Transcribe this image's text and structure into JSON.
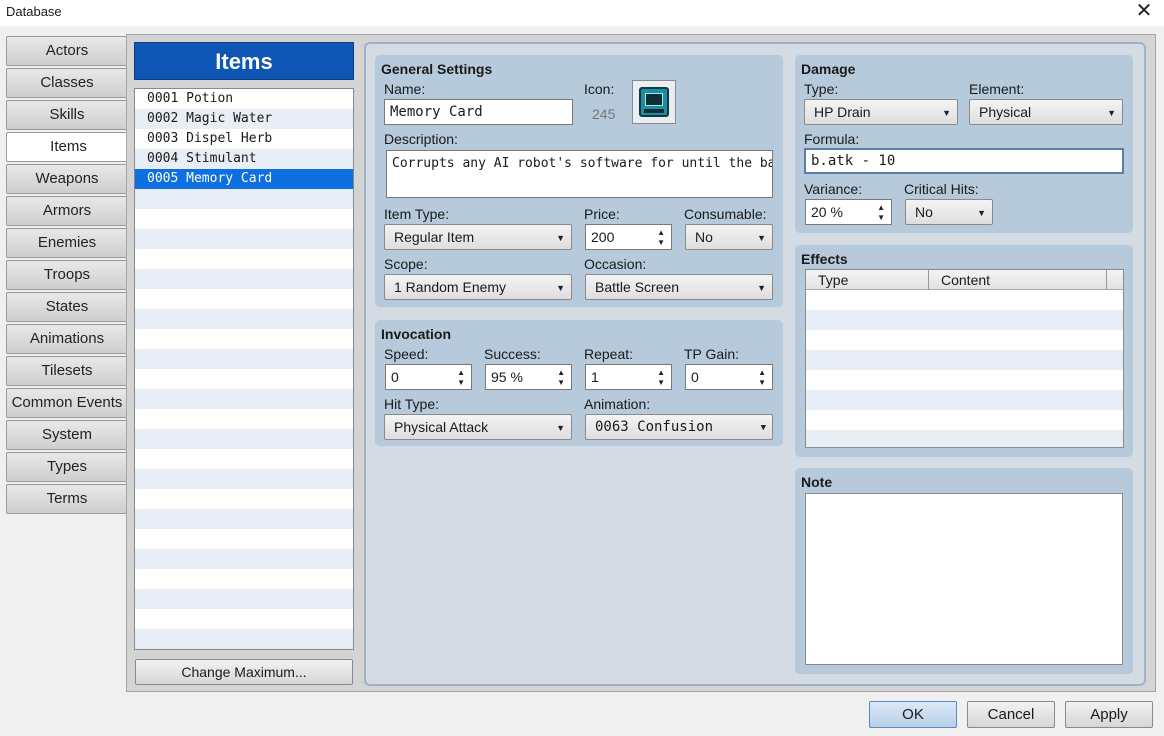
{
  "window": {
    "title": "Database",
    "close_icon": "close-icon"
  },
  "tabs": [
    {
      "label": "Actors"
    },
    {
      "label": "Classes"
    },
    {
      "label": "Skills"
    },
    {
      "label": "Items",
      "active": true
    },
    {
      "label": "Weapons"
    },
    {
      "label": "Armors"
    },
    {
      "label": "Enemies"
    },
    {
      "label": "Troops"
    },
    {
      "label": "States"
    },
    {
      "label": "Animations"
    },
    {
      "label": "Tilesets"
    },
    {
      "label": "Common Events"
    },
    {
      "label": "System"
    },
    {
      "label": "Types"
    },
    {
      "label": "Terms"
    }
  ],
  "items_list": {
    "title": "Items",
    "entries": [
      "0001 Potion",
      "0002 Magic Water",
      "0003 Dispel Herb",
      "0004 Stimulant",
      "0005 Memory Card"
    ],
    "selected_index": 4,
    "change_max_label": "Change Maximum..."
  },
  "general": {
    "title": "General Settings",
    "name_label": "Name:",
    "name_value": "Memory Card",
    "icon_label": "Icon:",
    "icon_index": "245",
    "icon_name": "computer-icon",
    "desc_label": "Description:",
    "desc_value": "Corrupts any AI robot's software for until the battle is",
    "item_type_label": "Item Type:",
    "item_type_value": "Regular Item",
    "price_label": "Price:",
    "price_value": "200",
    "consumable_label": "Consumable:",
    "consumable_value": "No",
    "scope_label": "Scope:",
    "scope_value": "1 Random Enemy",
    "occasion_label": "Occasion:",
    "occasion_value": "Battle Screen"
  },
  "invocation": {
    "title": "Invocation",
    "speed_label": "Speed:",
    "speed_value": "0",
    "success_label": "Success:",
    "success_value": "95 %",
    "repeat_label": "Repeat:",
    "repeat_value": "1",
    "tp_label": "TP Gain:",
    "tp_value": "0",
    "hit_type_label": "Hit Type:",
    "hit_type_value": "Physical Attack",
    "animation_label": "Animation:",
    "animation_value": "0063 Confusion"
  },
  "damage": {
    "title": "Damage",
    "type_label": "Type:",
    "type_value": "HP Drain",
    "element_label": "Element:",
    "element_value": "Physical",
    "formula_label": "Formula:",
    "formula_value": "b.atk - 10",
    "variance_label": "Variance:",
    "variance_value": "20 %",
    "critical_label": "Critical Hits:",
    "critical_value": "No"
  },
  "effects": {
    "title": "Effects",
    "columns": [
      "Type",
      "Content"
    ]
  },
  "note": {
    "title": "Note",
    "value": ""
  },
  "buttons": {
    "ok": "OK",
    "cancel": "Cancel",
    "apply": "Apply"
  },
  "colors": {
    "accent": "#0e55b4",
    "selection": "#0e6fe0",
    "panel": "#b6cadc"
  }
}
